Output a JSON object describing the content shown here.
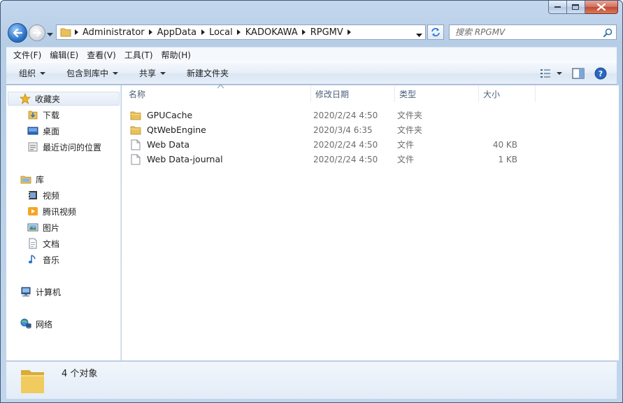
{
  "window": {
    "controls": {
      "minimize": "minimize",
      "maximize": "maximize",
      "close": "close"
    }
  },
  "navigation": {
    "breadcrumbs": [
      "Administrator",
      "AppData",
      "Local",
      "KADOKAWA",
      "RPGMV"
    ],
    "search_placeholder": "搜索 RPGMV"
  },
  "menu_bar": {
    "items": [
      "文件(F)",
      "编辑(E)",
      "查看(V)",
      "工具(T)",
      "帮助(H)"
    ]
  },
  "command_bar": {
    "organize": "组织",
    "include_in_library": "包含到库中",
    "share": "共享",
    "new_folder": "新建文件夹"
  },
  "sidebar": {
    "favorites_header": "收藏夹",
    "favorites": [
      "下载",
      "桌面",
      "最近访问的位置"
    ],
    "libraries_header": "库",
    "libraries": [
      "视频",
      "腾讯视频",
      "图片",
      "文档",
      "音乐"
    ],
    "computer": "计算机",
    "network": "网络"
  },
  "columns": {
    "name": "名称",
    "date": "修改日期",
    "type": "类型",
    "size": "大小"
  },
  "files": [
    {
      "name": "GPUCache",
      "date": "2020/2/24 4:50",
      "type": "文件夹",
      "size": "",
      "icon": "folder-icon"
    },
    {
      "name": "QtWebEngine",
      "date": "2020/3/4 6:35",
      "type": "文件夹",
      "size": "",
      "icon": "folder-icon"
    },
    {
      "name": "Web Data",
      "date": "2020/2/24 4:50",
      "type": "文件",
      "size": "40 KB",
      "icon": "file-icon"
    },
    {
      "name": "Web Data-journal",
      "date": "2020/2/24 4:50",
      "type": "文件",
      "size": "1 KB",
      "icon": "file-icon"
    }
  ],
  "details": {
    "item_count": "4 个对象"
  },
  "colors": {
    "frame": "#b9cfe8",
    "folder": "#e8c15a",
    "close_button": "#c9523c"
  }
}
